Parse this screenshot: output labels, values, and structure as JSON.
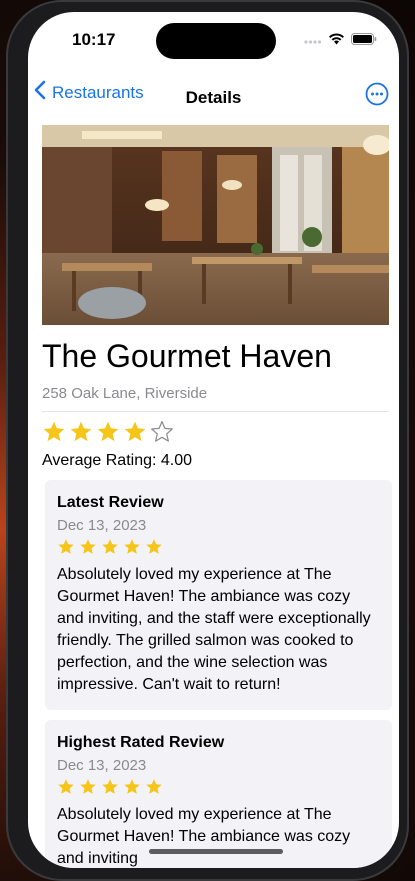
{
  "status_bar": {
    "time": "10:17"
  },
  "nav": {
    "back_label": "Restaurants",
    "title": "Details"
  },
  "restaurant": {
    "name": "The Gourmet Haven",
    "address": "258 Oak Lane, Riverside",
    "rating": 4,
    "rating_max": 5,
    "average_label": "Average Rating: 4.00"
  },
  "reviews": [
    {
      "heading": "Latest Review",
      "date": "Dec 13, 2023",
      "stars": 5,
      "text": "Absolutely loved my experience at The Gourmet Haven! The ambiance was cozy and inviting, and the staff were exceptionally friendly. The grilled salmon was cooked to perfection, and the wine selection was impressive. Can't wait to return!"
    },
    {
      "heading": "Highest Rated Review",
      "date": "Dec 13, 2023",
      "stars": 5,
      "text": "Absolutely loved my experience at The Gourmet Haven! The ambiance was cozy and inviting"
    }
  ],
  "colors": {
    "accent": "#1a73e8",
    "star": "#f5c518",
    "card_bg": "#f2f2f7",
    "secondary_text": "#8a8a8e"
  },
  "icons": [
    "chevron-left-icon",
    "more-ellipsis-icon",
    "star-filled-icon",
    "star-outline-icon",
    "signal-icon",
    "wifi-icon",
    "battery-icon"
  ]
}
